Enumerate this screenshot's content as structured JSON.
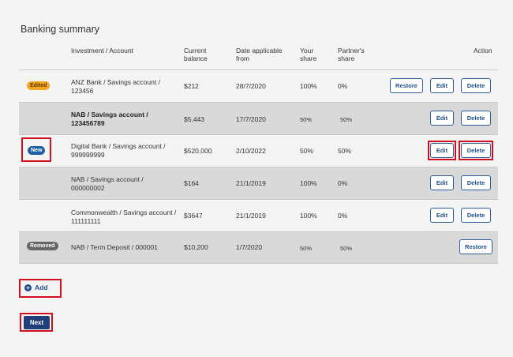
{
  "title": "Banking summary",
  "headers": {
    "account": "Investment / Account",
    "balance_1": "Current",
    "balance_2": "balance",
    "date_1": "Date applicable",
    "date_2": "from",
    "your_1": "Your",
    "your_2": "share",
    "partner_1": "Partner's",
    "partner_2": "share",
    "action": "Action"
  },
  "rows": [
    {
      "badge": "Edited",
      "account_1": "ANZ Bank / Savings account /",
      "account_2": "123456",
      "balance": "$212",
      "date": "28/7/2020",
      "your": "100%",
      "partner": "0%",
      "restore": "Restore",
      "edit": "Edit",
      "delete": "Delete"
    },
    {
      "badge": "",
      "account_1": "NAB / Savings account /",
      "account_2": "123456789",
      "balance": "$5,443",
      "date": "17/7/2020",
      "your": "50%",
      "partner": "50%",
      "edit": "Edit",
      "delete": "Delete"
    },
    {
      "badge": "New",
      "account_1": "Digital Bank / Savings account /",
      "account_2": "999999999",
      "balance": "$520,000",
      "date": "2/10/2022",
      "your": "50%",
      "partner": "50%",
      "edit": "Edit",
      "delete": "Delete"
    },
    {
      "badge": "",
      "account_1": "NAB / Savings account /",
      "account_2": "000000002",
      "balance": "$164",
      "date": "21/1/2019",
      "your": "100%",
      "partner": "0%",
      "edit": "Edit",
      "delete": "Delete"
    },
    {
      "badge": "",
      "account_1": "Commonwealth / Savings account /",
      "account_2": "111111111",
      "balance": "$3647",
      "date": "21/1/2019",
      "your": "100%",
      "partner": "0%",
      "edit": "Edit",
      "delete": "Delete"
    },
    {
      "badge": "Removed",
      "account_1": "NAB / Term Deposit / 000001",
      "balance": "$10,200",
      "date": "1/7/2020",
      "your": "50%",
      "partner": "50%",
      "restore": "Restore"
    }
  ],
  "add_label": "Add",
  "next_label": "Next",
  "colors": {
    "edited": "#f5a623",
    "new": "#1f5fa6",
    "removed": "#666666",
    "highlight": "#d0101e",
    "primary": "#1f3f7a"
  }
}
